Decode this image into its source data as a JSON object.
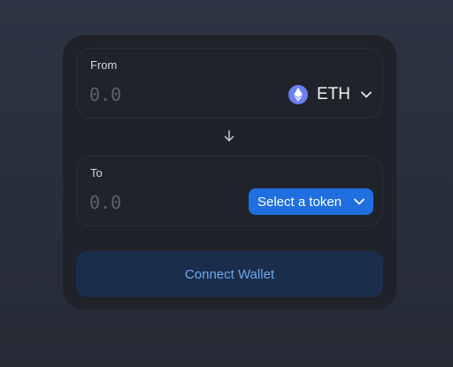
{
  "swap": {
    "from": {
      "label": "From",
      "amount_placeholder": "0.0",
      "token_symbol": "ETH",
      "token_icon": "ethereum-icon"
    },
    "to": {
      "label": "To",
      "amount_placeholder": "0.0",
      "select_label": "Select a token"
    },
    "switch_icon": "arrow-down-icon",
    "connect_label": "Connect Wallet"
  },
  "colors": {
    "accent": "#1f6fe0",
    "connect_bg": "#1a2d4b",
    "connect_text": "#6fa7ef",
    "eth_logo": "#6b7ff2"
  }
}
